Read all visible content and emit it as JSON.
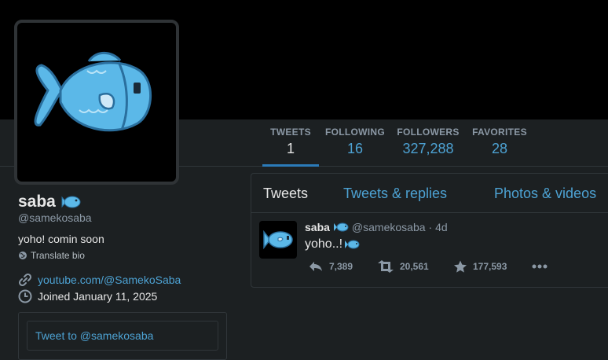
{
  "colors": {
    "accent": "#4da2d3",
    "banner": "#000000",
    "background": "#1c2022",
    "fish_body": "#5bb8e8",
    "fish_outline": "#2a6f9e"
  },
  "nav": {
    "stats": [
      {
        "label": "TWEETS",
        "value": "1"
      },
      {
        "label": "FOLLOWING",
        "value": "16"
      },
      {
        "label": "FOLLOWERS",
        "value": "327,288"
      },
      {
        "label": "FAVORITES",
        "value": "28"
      }
    ]
  },
  "profile": {
    "name": "saba",
    "name_icon": "fish-emoji-icon",
    "handle": "@samekosaba",
    "bio": "yoho! comin soon",
    "translate_label": "Translate bio",
    "website": "youtube.com/@SamekoSaba",
    "joined": "Joined January 11, 2025"
  },
  "compose": {
    "placeholder": "Tweet to @samekosaba"
  },
  "timeline": {
    "tabs": [
      "Tweets",
      "Tweets & replies",
      "Photos & videos"
    ],
    "tweet": {
      "name": "saba",
      "handle": "@samekosaba",
      "time": "· 4d",
      "text": "yoho..!",
      "replies": "7,389",
      "retweets": "20,561",
      "favorites": "177,593"
    }
  }
}
